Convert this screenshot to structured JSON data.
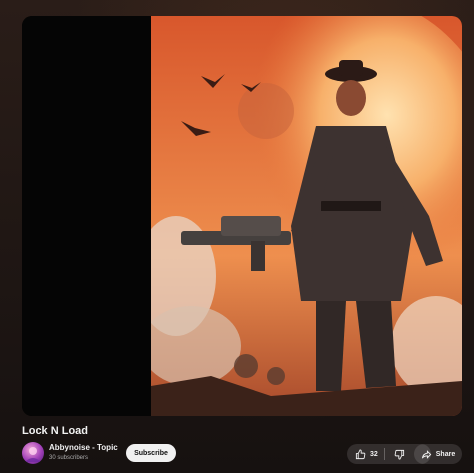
{
  "video": {
    "title": "Lock N Load",
    "artwork_desc_icon": "skeleton-gunslinger-artwork"
  },
  "channel": {
    "name": "Abbynoise - Topic",
    "subscribers": "30 subscribers"
  },
  "actions": {
    "subscribe_label": "Subscribe",
    "like_count": "32",
    "share_label": "Share"
  },
  "colors": {
    "accent": "#f1f1f1",
    "background": "#1c1513",
    "artwork_orange": "#e8763a"
  }
}
